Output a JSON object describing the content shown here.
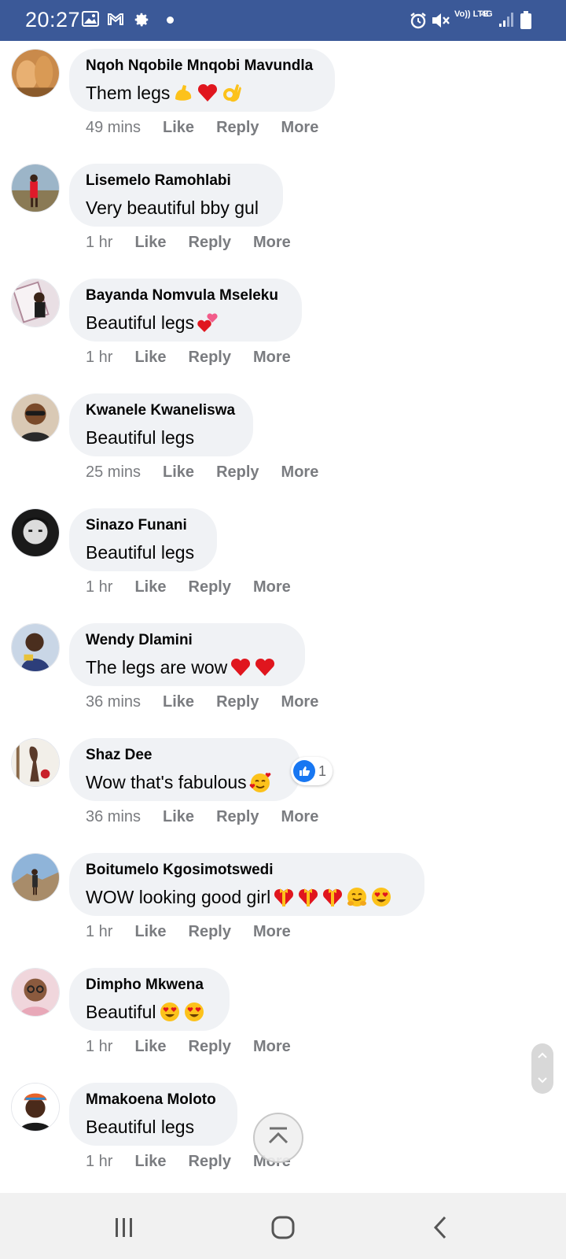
{
  "status_bar": {
    "time": "20:27",
    "left_icons": [
      "gallery-icon",
      "gmail-icon",
      "settings-gear-icon"
    ],
    "volte_label": "Vo)) LTE",
    "network_label": "4G",
    "right_icons": [
      "alarm-icon",
      "mute-icon",
      "signal-icon",
      "battery-icon"
    ],
    "bar_color": "#3b5998"
  },
  "comments": [
    {
      "author": "Nqoh Nqobile Mnqobi Mavundla",
      "text": "Them legs",
      "emojis": [
        "flexed-biceps",
        "red-heart",
        "ok-hand"
      ],
      "time": "49 mins",
      "actions": [
        "Like",
        "Reply",
        "More"
      ]
    },
    {
      "author": "Lisemelo Ramohlabi",
      "text": "Very beautiful bby gul",
      "emojis": [],
      "time": "1 hr",
      "actions": [
        "Like",
        "Reply",
        "More"
      ]
    },
    {
      "author": "Bayanda Nomvula Mseleku",
      "text": "Beautiful legs",
      "emojis": [
        "two-hearts"
      ],
      "time": "1 hr",
      "actions": [
        "Like",
        "Reply",
        "More"
      ]
    },
    {
      "author": "Kwanele Kwaneliswa",
      "text": "Beautiful legs",
      "emojis": [],
      "time": "25 mins",
      "actions": [
        "Like",
        "Reply",
        "More"
      ]
    },
    {
      "author": "Sinazo Funani",
      "text": "Beautiful legs",
      "emojis": [],
      "time": "1 hr",
      "actions": [
        "Like",
        "Reply",
        "More"
      ]
    },
    {
      "author": "Wendy Dlamini",
      "text": "The legs are wow ",
      "emojis": [
        "red-heart",
        "red-heart"
      ],
      "time": "36 mins",
      "actions": [
        "Like",
        "Reply",
        "More"
      ]
    },
    {
      "author": "Shaz Dee",
      "text": "Wow that's fabulous ",
      "emojis": [
        "smiling-face-with-hearts"
      ],
      "time": "36 mins",
      "actions": [
        "Like",
        "Reply",
        "More"
      ],
      "reaction_count": "1"
    },
    {
      "author": "Boitumelo Kgosimotswedi",
      "text": "WOW looking good girl ",
      "emojis": [
        "heart-with-ribbon",
        "heart-with-ribbon",
        "heart-with-ribbon",
        "hugging-face",
        "heart-eyes"
      ],
      "time": "1 hr",
      "actions": [
        "Like",
        "Reply",
        "More"
      ]
    },
    {
      "author": "Dimpho Mkwena",
      "text": "Beautiful ",
      "emojis": [
        "heart-eyes",
        "heart-eyes"
      ],
      "time": "1 hr",
      "actions": [
        "Like",
        "Reply",
        "More"
      ]
    },
    {
      "author": "Mmakoena Moloto",
      "text": "Beautiful legs",
      "emojis": [],
      "time": "1 hr",
      "actions": [
        "Like",
        "Reply",
        "More"
      ]
    }
  ],
  "floating": {
    "scroll_top_icon": "chevron-up-bar-icon",
    "side_scroll_icons": [
      "chevron-up-icon",
      "chevron-down-icon"
    ]
  },
  "nav_bar": {
    "icons": [
      "recent-apps-icon",
      "home-icon",
      "back-icon"
    ]
  },
  "colors": {
    "bubble": "#f0f2f5",
    "meta_text": "#7a7c80",
    "like_blue": "#1877f2"
  }
}
